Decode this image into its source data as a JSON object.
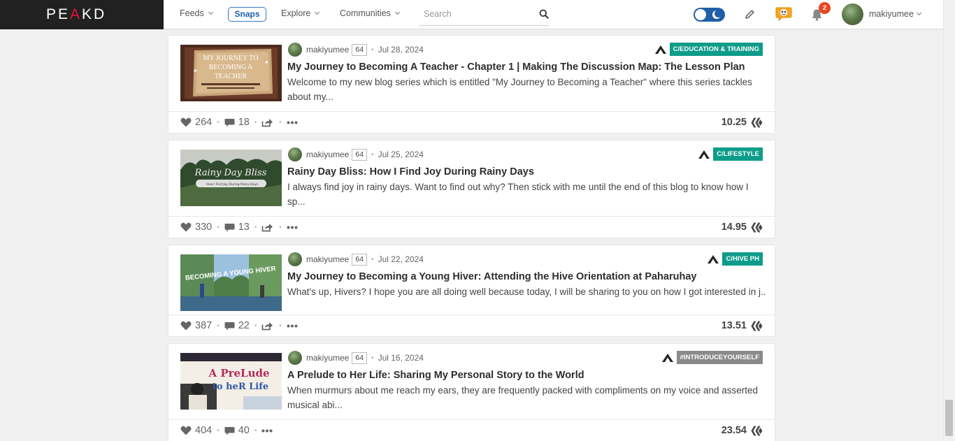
{
  "header": {
    "logo_left": "PE",
    "logo_k": "A",
    "logo_right": "KD",
    "nav": {
      "feeds": "Feeds",
      "snaps": "Snaps",
      "explore": "Explore",
      "communities": "Communities"
    },
    "search": {
      "placeholder": "Search",
      "value": ""
    },
    "notifications_count": "2",
    "username": "makiyumee"
  },
  "posts": [
    {
      "author": "makiyumee",
      "reputation": "64",
      "date": "Jul 28, 2024",
      "community": "C/EDUCATION & TRAINING",
      "title": "My Journey to Becoming A Teacher - Chapter 1 | Making The Discussion Map: The Lesson Plan",
      "excerpt": "Welcome to my new blog series which is entitled \"My Journey to Becoming a Teacher\" where this series tackles about my...",
      "thumb_line1": "MY JOURNEY TO",
      "thumb_line2": "BECOMING A",
      "thumb_line3": "TEACHER",
      "votes": "264",
      "comments": "18",
      "payout": "10.25"
    },
    {
      "author": "makiyumee",
      "reputation": "64",
      "date": "Jul 25, 2024",
      "community": "C/LIFESTYLE",
      "title": "Rainy Day Bliss: How I Find Joy During Rainy Days",
      "excerpt": "I always find joy in rainy days. Want to find out why? Then stick with me until the end of this blog to know how I sp...",
      "thumb_line1": "Rainy Day Bliss",
      "thumb_line2": "How I Find Joy During Rainy Days",
      "votes": "330",
      "comments": "13",
      "payout": "14.95"
    },
    {
      "author": "makiyumee",
      "reputation": "64",
      "date": "Jul 22, 2024",
      "community": "C/HIVE PH",
      "title": "My Journey to Becoming a Young Hiver: Attending the Hive Orientation at Paharuhay",
      "excerpt": "What's up, Hivers? I hope you are all doing well because today, I will be sharing to you on how I got interested in j...",
      "thumb_line1": "BECOMING A YOUNG HIVER",
      "votes": "387",
      "comments": "22",
      "payout": "13.51"
    },
    {
      "author": "makiyumee",
      "reputation": "64",
      "date": "Jul 16, 2024",
      "community": "#INTRODUCEYOURSELF",
      "title": "A Prelude to Her Life: Sharing My Personal Story to the World",
      "excerpt": "When murmurs about me reach my ears, they are frequently packed with compliments on my voice and asserted musical abi...",
      "thumb_line1": "A PreLude",
      "thumb_line2": "to heR Life",
      "votes": "404",
      "comments": "40",
      "payout": "23.54"
    }
  ],
  "colors": {
    "brand_red": "#e31337",
    "accent_blue": "#1f5fa8",
    "community_tag": "#0e9c8a",
    "hashtag_tag": "#8a8a8a",
    "notif_badge": "#e8461f"
  },
  "icons": [
    "search-icon",
    "theme-toggle",
    "pencil-icon",
    "chat-icon",
    "bell-icon",
    "heart-icon",
    "comment-icon",
    "share-icon",
    "more-icon",
    "hive-icon",
    "community-caret-icon"
  ]
}
